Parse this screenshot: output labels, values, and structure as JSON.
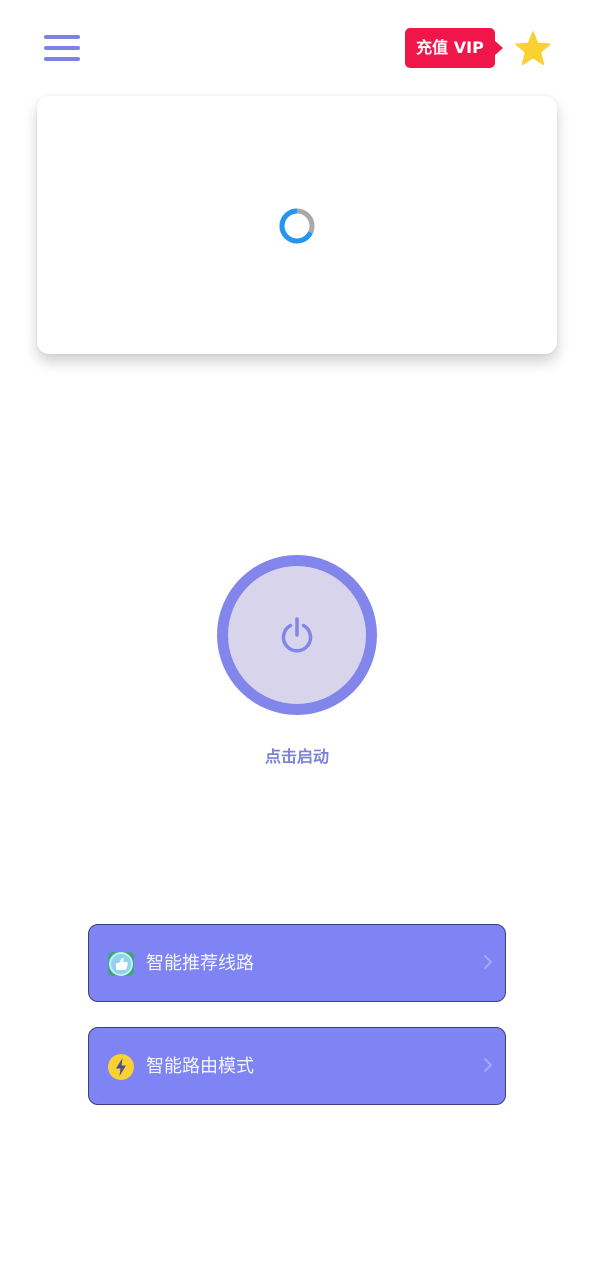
{
  "header": {
    "menu_icon": "hamburger-menu-icon",
    "vip_label": "充值 VIP",
    "favorite_icon": "star-icon"
  },
  "status_card": {
    "loading_indicator": "loading-spinner"
  },
  "power": {
    "icon": "power-icon",
    "label": "点击启动"
  },
  "options": [
    {
      "label": "智能推荐线路",
      "icon": "thumbs-up-icon"
    },
    {
      "label": "智能路由模式",
      "icon": "lightning-icon"
    }
  ],
  "colors": {
    "accent": "#7e84f4",
    "vip_red": "#f0164a",
    "star_yellow": "#f9d130",
    "spinner_blue": "#2196f3",
    "power_inner": "#d7d4ec"
  }
}
